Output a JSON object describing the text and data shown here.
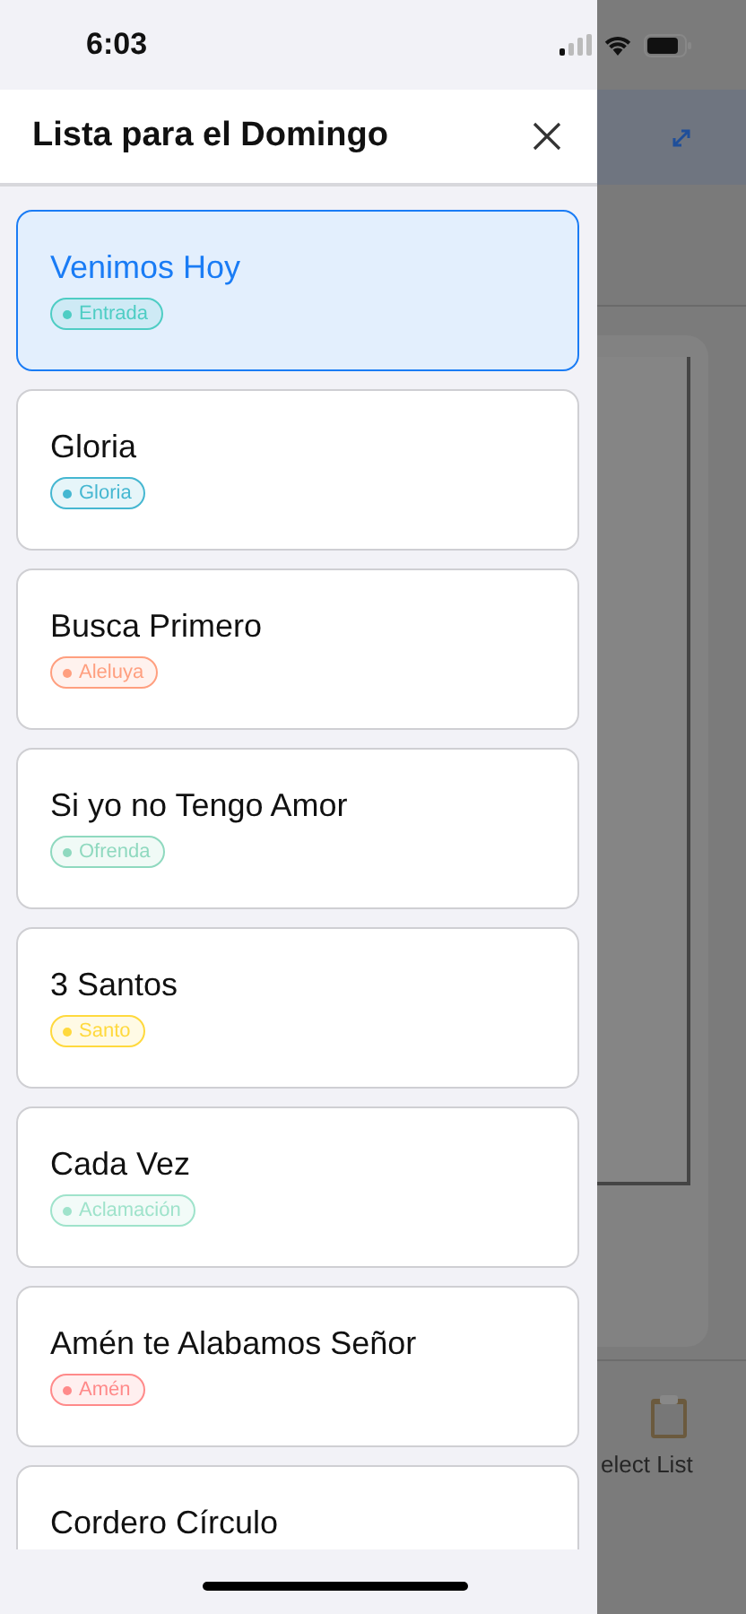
{
  "status_bar": {
    "time": "6:03"
  },
  "sheet": {
    "title": "Lista para el Domingo",
    "items": [
      {
        "title": "Venimos Hoy",
        "tag": "Entrada",
        "color": "#4ecdc4",
        "selected": true
      },
      {
        "title": "Gloria",
        "tag": "Gloria",
        "color": "#45b7d1",
        "selected": false
      },
      {
        "title": "Busca Primero",
        "tag": "Aleluya",
        "color": "#ff9f7f",
        "selected": false
      },
      {
        "title": "Si yo no Tengo Amor",
        "tag": "Ofrenda",
        "color": "#8fd9bf",
        "selected": false
      },
      {
        "title": "3 Santos",
        "tag": "Santo",
        "color": "#ffd93d",
        "selected": false
      },
      {
        "title": "Cada Vez",
        "tag": "Aclamación",
        "color": "#9fe3cb",
        "selected": false
      },
      {
        "title": "Amén te Alabamos Señor",
        "tag": "Amén",
        "color": "#ff8a8a",
        "selected": false
      },
      {
        "title": "Cordero Círculo",
        "selected": false
      }
    ]
  },
  "background": {
    "tab_label": "elect List"
  }
}
